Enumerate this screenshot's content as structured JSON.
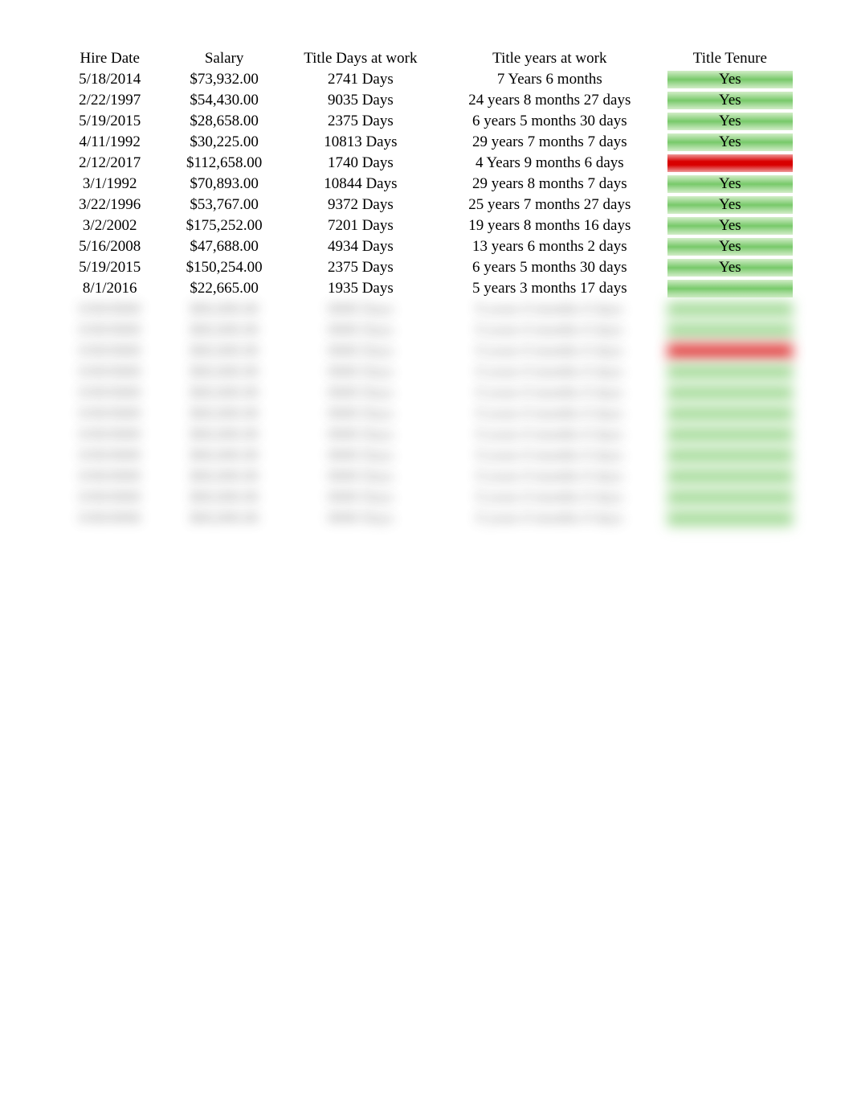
{
  "table": {
    "headers": {
      "hire_date": "Hire Date",
      "salary": "Salary",
      "days": "Title Days at work",
      "years": "Title years at work",
      "tenure": "Title Tenure"
    },
    "rows": [
      {
        "hire_date": "5/18/2014",
        "salary": "$73,932.00",
        "days": "2741 Days",
        "years": "7 Years 6 months",
        "tenure": "Yes",
        "tenure_status": "yes"
      },
      {
        "hire_date": "2/22/1997",
        "salary": "$54,430.00",
        "days": "9035 Days",
        "years": "24 years 8 months 27 days",
        "tenure": "Yes",
        "tenure_status": "yes"
      },
      {
        "hire_date": "5/19/2015",
        "salary": "$28,658.00",
        "days": "2375 Days",
        "years": "6 years 5 months 30 days",
        "tenure": "Yes",
        "tenure_status": "yes"
      },
      {
        "hire_date": "4/11/1992",
        "salary": "$30,225.00",
        "days": "10813 Days",
        "years": "29 years 7 months 7 days",
        "tenure": "Yes",
        "tenure_status": "yes"
      },
      {
        "hire_date": "2/12/2017",
        "salary": "$112,658.00",
        "days": "1740 Days",
        "years": "4 Years 9 months 6 days",
        "tenure": "",
        "tenure_status": "no"
      },
      {
        "hire_date": "3/1/1992",
        "salary": "$70,893.00",
        "days": "10844 Days",
        "years": "29 years 8 months 7 days",
        "tenure": "Yes",
        "tenure_status": "yes"
      },
      {
        "hire_date": "3/22/1996",
        "salary": "$53,767.00",
        "days": "9372 Days",
        "years": "25 years 7 months 27 days",
        "tenure": "Yes",
        "tenure_status": "yes"
      },
      {
        "hire_date": "3/2/2002",
        "salary": "$175,252.00",
        "days": "7201 Days",
        "years": "19 years 8 months 16 days",
        "tenure": "Yes",
        "tenure_status": "yes"
      },
      {
        "hire_date": "5/16/2008",
        "salary": "$47,688.00",
        "days": "4934 Days",
        "years": "13 years 6 months 2 days",
        "tenure": "Yes",
        "tenure_status": "yes"
      },
      {
        "hire_date": "5/19/2015",
        "salary": "$150,254.00",
        "days": "2375 Days",
        "years": "6 years 5 months 30 days",
        "tenure": "Yes",
        "tenure_status": "yes"
      },
      {
        "hire_date": "8/1/2016",
        "salary": "$22,665.00",
        "days": "1935 Days",
        "years": "5 years 3 months 17 days",
        "tenure": "",
        "tenure_status": "yes"
      }
    ],
    "blurred_rows": [
      {
        "tenure_status": "yes"
      },
      {
        "tenure_status": "yes"
      },
      {
        "tenure_status": "no"
      },
      {
        "tenure_status": "yes"
      },
      {
        "tenure_status": "yes"
      },
      {
        "tenure_status": "yes"
      },
      {
        "tenure_status": "yes"
      },
      {
        "tenure_status": "yes"
      },
      {
        "tenure_status": "yes"
      },
      {
        "tenure_status": "yes"
      },
      {
        "tenure_status": "yes"
      }
    ]
  }
}
